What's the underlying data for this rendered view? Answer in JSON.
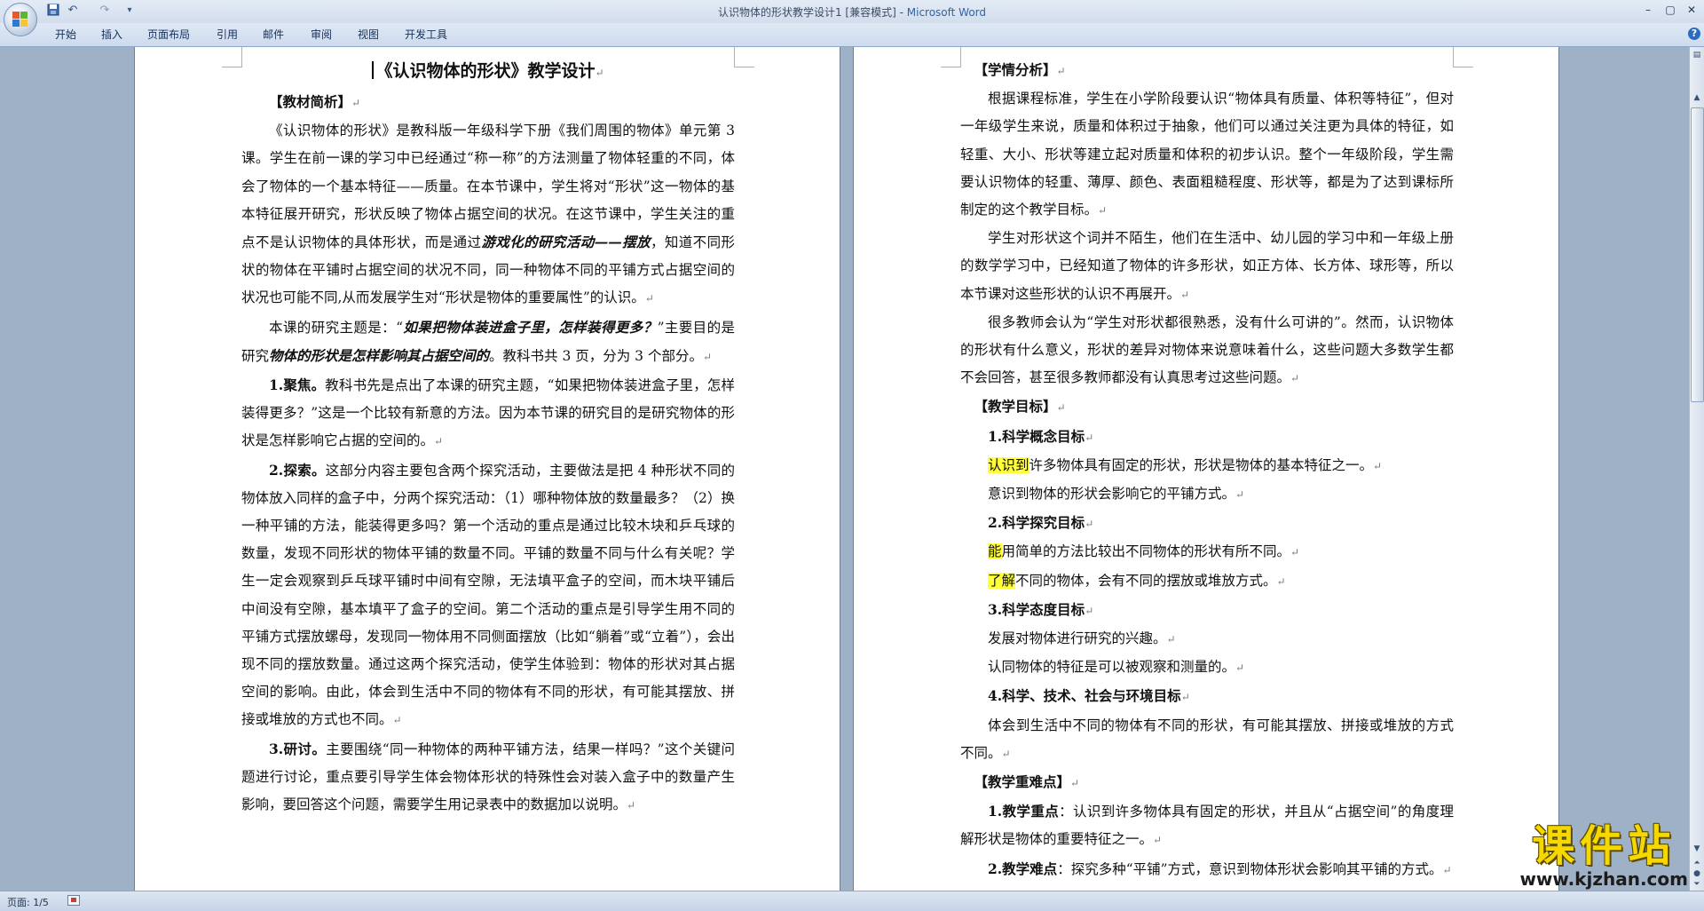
{
  "window": {
    "doc_name": "认识物体的形状教学设计1 [兼容模式] - ",
    "app_name": "Microsoft Word",
    "minimize": "–",
    "restore": "▢",
    "close": "✕"
  },
  "quick_access": {
    "save_icon": "save-icon",
    "undo": "↶",
    "redo": "↷",
    "more": "▾"
  },
  "ribbon_tabs": [
    "开始",
    "插入",
    "页面布局",
    "引用",
    "邮件",
    "审阅",
    "视图",
    "开发工具"
  ],
  "help": "?",
  "status": {
    "page": "页面: 1/5"
  },
  "watermark": {
    "title": "课件站",
    "url": "www.kjzhan.com"
  },
  "mark": "↵",
  "left_page": {
    "title": "《认识物体的形状》教学设计",
    "h1": "【教材简析】",
    "p1": "《认识物体的形状》是教科版一年级科学下册《我们周围的物体》单元第 3 课。学生在前一课的学习中已经通过“称一称”的方法测量了物体轻重的不同，体会了物体的一个基本特征——质量。在本节课中，学生将对“形状”这一物体的基本特征展开研究，形状反映了物体占据空间的状况。在这节课中，学生关注的重点不是认识物体的具体形状，而是通过",
    "p1_em": "游戏化的研究活动——摆放",
    "p1_end": "，知道不同形状的物体在平铺时占据空间的状况不同，同一种物体不同的平铺方式占据空间的状况也可能不同,从而发展学生对“形状是物体的重要属性”的认识。",
    "p2_a": "本课的研究主题是：“",
    "p2_em1": "如果把物体装进盒子里，怎样装得更多？",
    "p2_b": "”主要目的是研究",
    "p2_em2": "物体的形状是怎样影响其占据空间的",
    "p2_c": "。教科书共 3 页，分为 3 个部分。",
    "p3_label": "1.聚焦。",
    "p3": "教科书先是点出了本课的研究主题，“如果把物体装进盒子里，怎样装得更多？”这是一个比较有新意的方法。因为本节课的研究目的是研究物体的形状是怎样影响它占据的空间的。",
    "p4_label": "2.探索。",
    "p4": "这部分内容主要包含两个探究活动，主要做法是把 4 种形状不同的物体放入同样的盒子中，分两个探究活动：（1）哪种物体放的数量最多？（2）换一种平铺的方法，能装得更多吗？第一个活动的重点是通过比较木块和乒乓球的数量，发现不同形状的物体平铺的数量不同。平铺的数量不同与什么有关呢？学生一定会观察到乒乓球平铺时中间有空隙，无法填平盒子的空间，而木块平铺后中间没有空隙，基本填平了盒子的空间。第二个活动的重点是引导学生用不同的平铺方式摆放螺母，发现同一物体用不同侧面摆放（比如“躺着”或“立着”），会出现不同的摆放数量。通过这两个探究活动，使学生体验到：物体的形状对其占据空间的影响。由此，体会到生活中不同的物体有不同的形状，有可能其摆放、拼接或堆放的方式也不同。",
    "p5_label": "3.研讨。",
    "p5": "主要围绕“同一种物体的两种平铺方法，结果一样吗？”这个关键问题进行讨论，重点要引导学生体会物体形状的特殊性会对装入盒子中的数量产生影响，要回答这个问题，需要学生用记录表中的数据加以说明。"
  },
  "right_page": {
    "h1": "【学情分析】",
    "p1": "根据课程标准，学生在小学阶段要认识“物体具有质量、体积等特征”，但对一年级学生来说，质量和体积过于抽象，他们可以通过关注更为具体的特征，如轻重、大小、形状等建立起对质量和体积的初步认识。整个一年级阶段，学生需要认识物体的轻重、薄厚、颜色、表面粗糙程度、形状等，都是为了达到课标所制定的这个教学目标。",
    "p2": "学生对形状这个词并不陌生，他们在生活中、幼儿园的学习中和一年级上册的数学学习中，已经知道了物体的许多形状，如正方体、长方体、球形等，所以本节课对这些形状的认识不再展开。",
    "p3": "很多教师会认为“学生对形状都很熟悉，没有什么可讲的”。然而，认识物体的形状有什么意义，形状的差异对物体来说意味着什么，这些问题大多数学生都不会回答，甚至很多教师都没有认真思考过这些问题。",
    "h2": "【教学目标】",
    "s1": "1.科学概念目标",
    "g1_hl": "认识到",
    "g1": "许多物体具有固定的形状，形状是物体的基本特征之一。",
    "g2": "意识到物体的形状会影响它的平铺方式。",
    "s2": "2.科学探究目标",
    "g3_hl": "能",
    "g3": "用简单的方法比较出不同物体的形状有所不同。",
    "g4_hl": "了解",
    "g4": "不同的物体，会有不同的摆放或堆放方式。",
    "s3": "3.科学态度目标",
    "g5": "发展对物体进行研究的兴趣。",
    "g6": "认同物体的特征是可以被观察和测量的。",
    "s4": "4.科学、技术、社会与环境目标",
    "g7": "体会到生活中不同的物体有不同的形状，有可能其摆放、拼接或堆放的方式不同。",
    "h3": "【教学重难点】",
    "k1_label": "1.教学重点",
    "k1": "：认识到许多物体具有固定的形状，并且从“占据空间”的角度理解形状是物体的重要特征之一。",
    "k2_label": "2.教学难点",
    "k2": "：探究多种“平铺”方式，意识到物体形状会影响其平铺的方式。"
  }
}
